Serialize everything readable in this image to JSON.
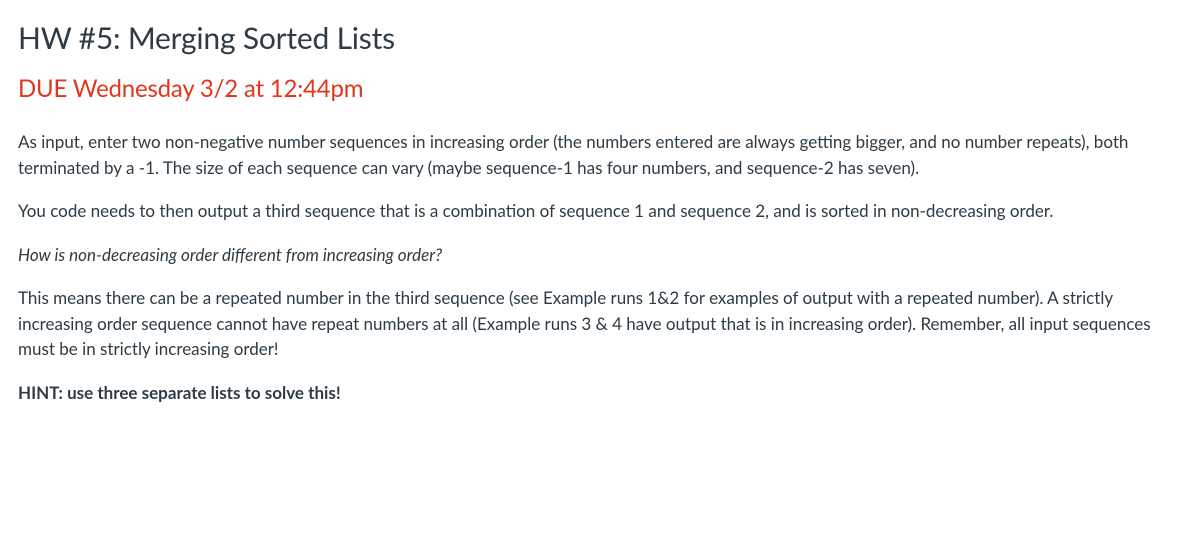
{
  "title": "HW #5: Merging Sorted Lists",
  "due": "DUE Wednesday 3/2 at 12:44pm",
  "paragraphs": {
    "p1": "As input, enter two non-negative number sequences in increasing order (the numbers entered are always getting bigger, and no number repeats), both terminated by a -1. The size of each sequence can vary (maybe sequence-1 has four numbers, and sequence-2 has seven).",
    "p2": "You code needs to then output a third sequence that is a combination of sequence 1 and sequence 2, and is sorted in non-decreasing order.",
    "p3": "How is non-decreasing order different from increasing order?",
    "p4": "This means there can be a repeated number in the third sequence (see Example runs 1&2 for examples of output with a repeated number). A strictly increasing order sequence cannot have repeat numbers at all (Example runs 3 & 4 have output that is in increasing order). Remember, all input sequences must be in strictly increasing order!",
    "hint": "HINT: use three separate lists to solve this!"
  }
}
